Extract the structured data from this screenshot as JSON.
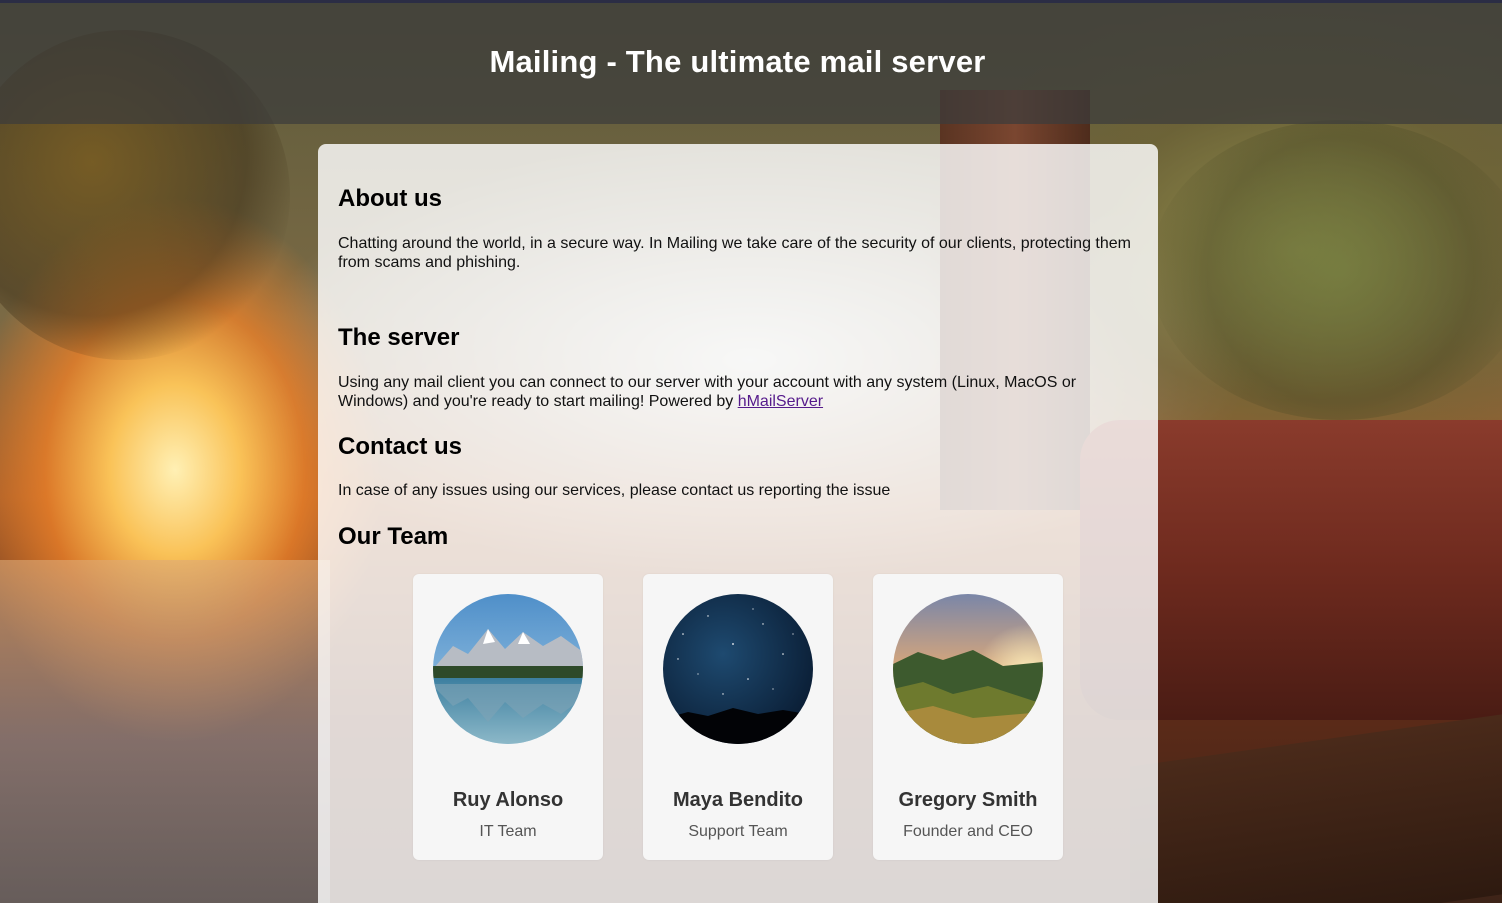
{
  "header": {
    "title": "Mailing - The ultimate mail server"
  },
  "sections": {
    "about": {
      "heading": "About us",
      "text": "Chatting around the world, in a secure way. In Mailing we take care of the security of our clients, protecting them from scams and phishing."
    },
    "server": {
      "heading": "The server",
      "text": "Using any mail client you can connect to our server with your account with any system (Linux, MacOS or Windows) and you're ready to start mailing! Powered by ",
      "link_label": "hMailServer"
    },
    "contact": {
      "heading": "Contact us",
      "text": "In case of any issues using our services, please contact us reporting the issue"
    },
    "team": {
      "heading": "Our Team",
      "members": [
        {
          "name": "Ruy Alonso",
          "role": "IT Team",
          "photo": "mountain-lake-photo"
        },
        {
          "name": "Maya Bendito",
          "role": "Support Team",
          "photo": "night-sky-photo"
        },
        {
          "name": "Gregory Smith",
          "role": "Founder and CEO",
          "photo": "sunset-hills-photo"
        }
      ]
    }
  },
  "colors": {
    "header_bg": "#3c3c3c",
    "link": "#551a8b",
    "panel_bg": "#ffffff",
    "card_bg": "#f6f6f6"
  }
}
